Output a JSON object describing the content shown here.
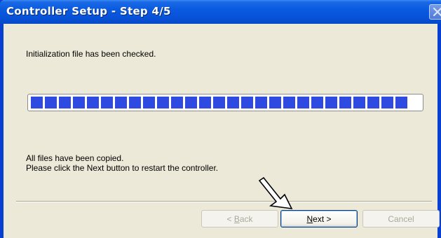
{
  "window": {
    "title": "Controller Setup - Step 4/5"
  },
  "content": {
    "status_message": "Initialization file has been checked.",
    "progress": 1.0,
    "completion_line1": "All files have been copied.",
    "completion_line2": "Please click the Next button to restart the controller."
  },
  "buttons": {
    "back": {
      "prefix": "< ",
      "mnemonic": "B",
      "rest": "ack"
    },
    "next": {
      "mnemonic": "N",
      "rest": "ext",
      "suffix": " >"
    },
    "cancel": "Cancel"
  },
  "icons": {
    "close": "close-icon",
    "pointer": "arrow-pointer-icon"
  },
  "colors": {
    "titlebar": "#0852d8",
    "progress_block": "#2e4ae0",
    "dialog_bg": "#ece9d8"
  }
}
